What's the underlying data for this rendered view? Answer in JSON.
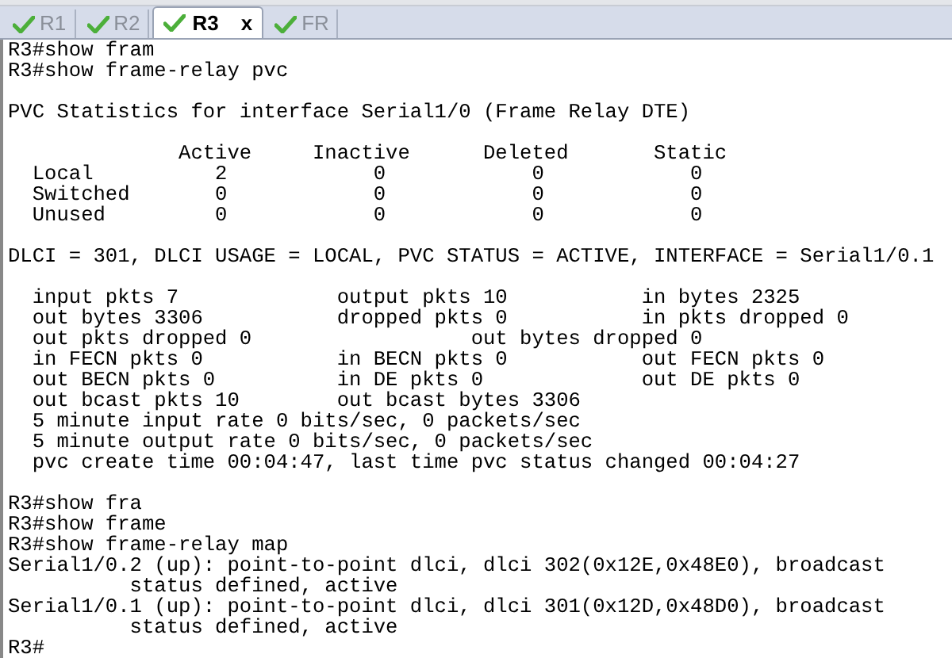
{
  "tabs": [
    {
      "label": "R1",
      "selected": false,
      "closable": false
    },
    {
      "label": "R2",
      "selected": false,
      "closable": false
    },
    {
      "label": "R3",
      "selected": true,
      "closable": true,
      "close_glyph": "x"
    },
    {
      "label": "FR",
      "selected": false,
      "closable": false
    }
  ],
  "terminal": {
    "blocks": [
      [
        "R3#show fram",
        "R3#show frame-relay pvc"
      ],
      [
        "PVC Statistics for interface Serial1/0 (Frame Relay DTE)"
      ],
      [
        "              Active     Inactive      Deleted       Static",
        "  Local          2            0            0            0",
        "  Switched       0            0            0            0",
        "  Unused         0            0            0            0"
      ],
      [
        "DLCI = 301, DLCI USAGE = LOCAL, PVC STATUS = ACTIVE, INTERFACE = Serial1/0.1"
      ],
      [
        "  input pkts 7             output pkts 10           in bytes 2325",
        "  out bytes 3306           dropped pkts 0           in pkts dropped 0",
        "  out pkts dropped 0                  out bytes dropped 0",
        "  in FECN pkts 0           in BECN pkts 0           out FECN pkts 0",
        "  out BECN pkts 0          in DE pkts 0             out DE pkts 0",
        "  out bcast pkts 10        out bcast bytes 3306",
        "  5 minute input rate 0 bits/sec, 0 packets/sec",
        "  5 minute output rate 0 bits/sec, 0 packets/sec",
        "  pvc create time 00:04:47, last time pvc status changed 00:04:27"
      ],
      [
        "R3#show fra",
        "R3#show frame",
        "R3#show frame-relay map",
        "Serial1/0.2 (up): point-to-point dlci, dlci 302(0x12E,0x48E0), broadcast",
        "          status defined, active",
        "Serial1/0.1 (up): point-to-point dlci, dlci 301(0x12D,0x48D0), broadcast",
        "          status defined, active",
        "R3#"
      ]
    ]
  }
}
